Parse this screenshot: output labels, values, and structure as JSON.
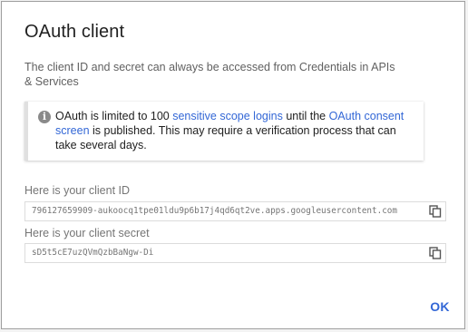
{
  "dialog": {
    "title": "OAuth client",
    "description": "The client ID and secret can always be accessed from Credentials in APIs & Services",
    "notice": {
      "icon": "info-icon",
      "text_1": "OAuth is limited to 100 ",
      "link_1": "sensitive scope logins",
      "text_2": " until the ",
      "link_2": "OAuth consent screen",
      "text_3": " is published. This may require a verification process that can take several days."
    },
    "client_id": {
      "label": "Here is your client ID",
      "value": "796127659909-aukoocq1tpe01ldu9p6b17j4qd6qt2ve.apps.googleusercontent.com"
    },
    "client_secret": {
      "label": "Here is your client secret",
      "value": "sD5t5cE7uzQVmQzbBaNgw-Di"
    },
    "ok_label": "OK"
  },
  "colors": {
    "link": "#3367d6",
    "title": "#212121",
    "muted": "#616161"
  }
}
